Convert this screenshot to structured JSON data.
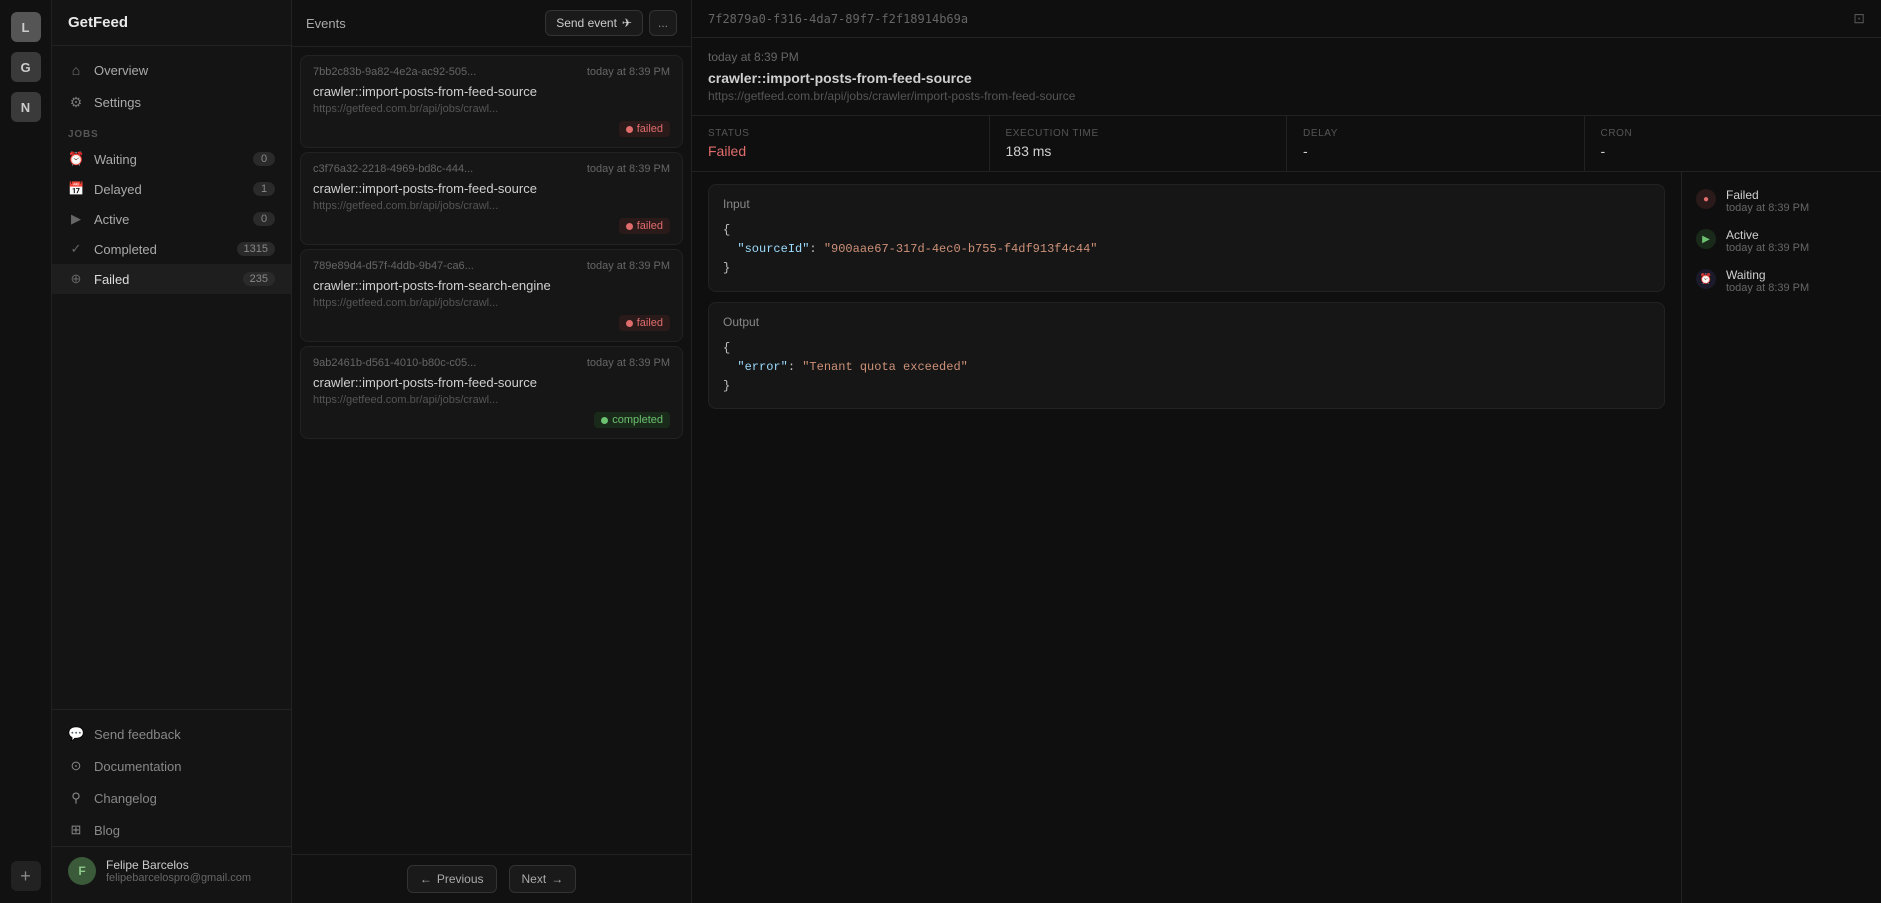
{
  "iconBar": {
    "topAvatars": [
      {
        "label": "L",
        "active": true
      },
      {
        "label": "G",
        "active": false
      },
      {
        "label": "N",
        "active": false
      }
    ],
    "plus": "+"
  },
  "sidebar": {
    "appName": "GetFeed",
    "nav": [
      {
        "id": "overview",
        "label": "Overview",
        "icon": "⌂"
      },
      {
        "id": "settings",
        "label": "Settings",
        "icon": "⚙"
      }
    ],
    "jobsSection": "JOBS",
    "jobs": [
      {
        "id": "waiting",
        "label": "Waiting",
        "icon": "⏰",
        "count": "0"
      },
      {
        "id": "delayed",
        "label": "Delayed",
        "icon": "📅",
        "count": "1"
      },
      {
        "id": "active",
        "label": "Active",
        "icon": "▶",
        "count": "0"
      },
      {
        "id": "completed",
        "label": "Completed",
        "icon": "✓",
        "count": "1315"
      },
      {
        "id": "failed",
        "label": "Failed",
        "icon": "⊕",
        "count": "235",
        "active": true
      }
    ],
    "footer": [
      {
        "id": "send-feedback",
        "label": "Send feedback",
        "icon": "💬"
      },
      {
        "id": "documentation",
        "label": "Documentation",
        "icon": "⊙"
      },
      {
        "id": "changelog",
        "label": "Changelog",
        "icon": "⚲"
      },
      {
        "id": "blog",
        "label": "Blog",
        "icon": "⊞"
      }
    ],
    "user": {
      "initial": "F",
      "name": "Felipe Barcelos",
      "email": "felipebarcelospro@gmail.com"
    }
  },
  "jobList": {
    "headerTitle": "Events",
    "sendEventBtn": "Send event",
    "moreBtn": "...",
    "jobs": [
      {
        "id": "7bb2c83b-9a82-4e2a-ac92-505...",
        "time": "today at 8:39 PM",
        "name": "crawler::import-posts-from-feed-source",
        "url": "https://getfeed.com.br/api/jobs/crawl...",
        "status": "failed"
      },
      {
        "id": "c3f76a32-2218-4969-bd8c-444...",
        "time": "today at 8:39 PM",
        "name": "crawler::import-posts-from-feed-source",
        "url": "https://getfeed.com.br/api/jobs/crawl...",
        "status": "failed"
      },
      {
        "id": "789e89d4-d57f-4ddb-9b47-ca6...",
        "time": "today at 8:39 PM",
        "name": "crawler::import-posts-from-search-engine",
        "url": "https://getfeed.com.br/api/jobs/crawl...",
        "status": "failed"
      },
      {
        "id": "9ab2461b-d561-4010-b80c-c05...",
        "time": "today at 8:39 PM",
        "name": "crawler::import-posts-from-feed-source",
        "url": "https://getfeed.com.br/api/jobs/crawl...",
        "status": "completed"
      }
    ],
    "prevBtn": "Previous",
    "nextBtn": "Next"
  },
  "detail": {
    "jobId": "7f2879a0-f316-4da7-89f7-f2f18914b69a",
    "time": "today at 8:39 PM",
    "jobName": "crawler::import-posts-from-feed-source",
    "jobUrl": "https://getfeed.com.br/api/jobs/crawler/import-posts-from-feed-source",
    "meta": {
      "statusLabel": "STATUS",
      "statusValue": "Failed",
      "execTimeLabel": "EXECUTION TIME",
      "execTimeValue": "183 ms",
      "delayLabel": "DELAY",
      "delayValue": "-",
      "cronLabel": "CRON",
      "cronValue": "-"
    },
    "input": {
      "label": "Input",
      "code": "{\n  \"sourceId\": \"900aae67-317d-4ec0-b755-f4df913f4c44\"\n}"
    },
    "output": {
      "label": "Output",
      "code": "{\n  \"error\": \"Tenant quota exceeded\"\n}"
    },
    "timeline": [
      {
        "status": "Failed",
        "time": "today at 8:39 PM",
        "type": "failed",
        "icon": "●"
      },
      {
        "status": "Active",
        "time": "today at 8:39 PM",
        "type": "active",
        "icon": "▶"
      },
      {
        "status": "Waiting",
        "time": "today at 8:39 PM",
        "type": "waiting",
        "icon": "⏰"
      }
    ]
  }
}
